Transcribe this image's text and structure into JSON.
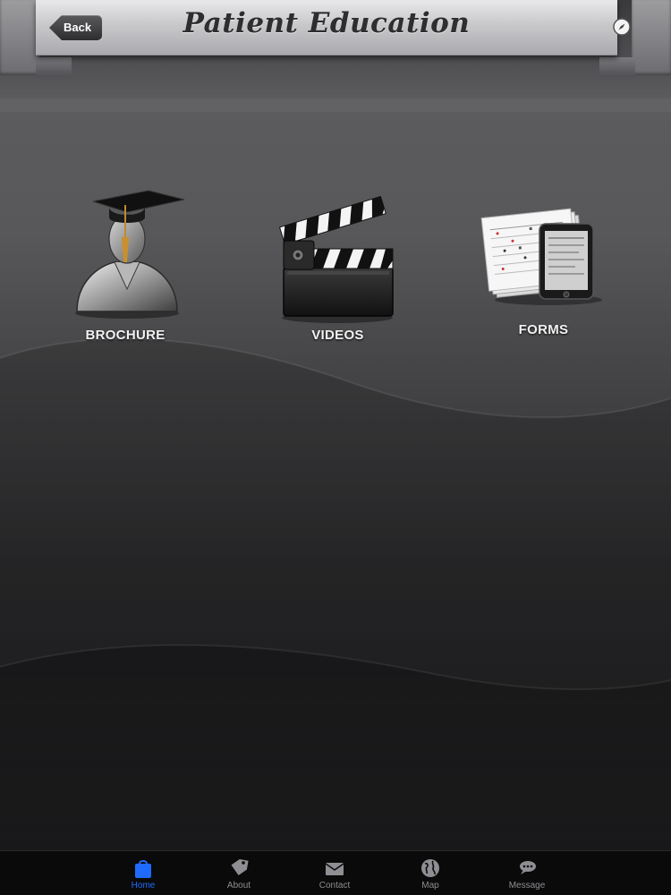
{
  "header": {
    "title": "Patient Education",
    "back_label": "Back"
  },
  "grid": {
    "items": [
      {
        "label": "BROCHURE",
        "icon": "graduate-icon"
      },
      {
        "label": "VIDEOS",
        "icon": "clapperboard-icon"
      },
      {
        "label": "FORMS",
        "icon": "forms-tablet-icon"
      }
    ]
  },
  "tabbar": {
    "active": "Home",
    "active_color": "#1f6bff",
    "items": [
      {
        "label": "Home",
        "icon": "home-bag-icon"
      },
      {
        "label": "About",
        "icon": "tag-icon"
      },
      {
        "label": "Contact",
        "icon": "envelope-icon"
      },
      {
        "label": "Map",
        "icon": "globe-icon"
      },
      {
        "label": "Message",
        "icon": "speech-bubbles-icon"
      }
    ]
  }
}
